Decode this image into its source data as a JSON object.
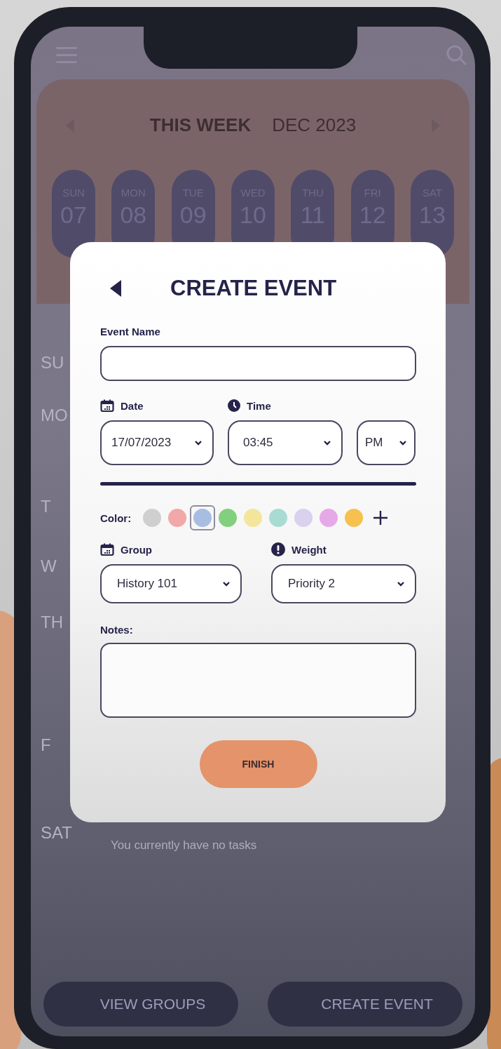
{
  "background": {
    "week_title": "THIS WEEK",
    "week_month": "DEC 2023",
    "days": [
      {
        "name": "SUN",
        "date": "07"
      },
      {
        "name": "MON",
        "date": "08"
      },
      {
        "name": "TUE",
        "date": "09"
      },
      {
        "name": "WED",
        "date": "10"
      },
      {
        "name": "THU",
        "date": "11"
      },
      {
        "name": "FRI",
        "date": "12"
      },
      {
        "name": "SAT",
        "date": "13"
      }
    ],
    "day_rows": [
      {
        "label": "SU"
      },
      {
        "label": "MO"
      },
      {
        "label": "T"
      },
      {
        "label": "W"
      },
      {
        "label": "TH"
      },
      {
        "label": "F"
      },
      {
        "label": "SAT",
        "message": "You currently have no tasks"
      }
    ],
    "bottom_buttons": [
      "VIEW GROUPS",
      "CREATE EVENT"
    ]
  },
  "dialog": {
    "title": "CREATE EVENT",
    "event_name": {
      "label": "Event Name"
    },
    "date": {
      "label": "Date",
      "value": "17/07/2023"
    },
    "time": {
      "label": "Time",
      "value": "03:45",
      "period": "PM"
    },
    "color_label": "Color:",
    "colors": [
      {
        "color": "#cfcfcf",
        "selected": false
      },
      {
        "color": "#f2a8a8",
        "selected": false
      },
      {
        "color": "#a8bde2",
        "selected": true
      },
      {
        "color": "#82d07e",
        "selected": false
      },
      {
        "color": "#f3e69a",
        "selected": false
      },
      {
        "color": "#a8dcd2",
        "selected": false
      },
      {
        "color": "#d9d1ee",
        "selected": false
      },
      {
        "color": "#e5a9e8",
        "selected": false
      },
      {
        "color": "#f7c150",
        "selected": false
      }
    ],
    "group": {
      "label": "Group",
      "value": "History 101"
    },
    "weight": {
      "label": "Weight",
      "value": "Priority 2"
    },
    "notes": {
      "label": "Notes:"
    },
    "finish": "FINISH"
  }
}
